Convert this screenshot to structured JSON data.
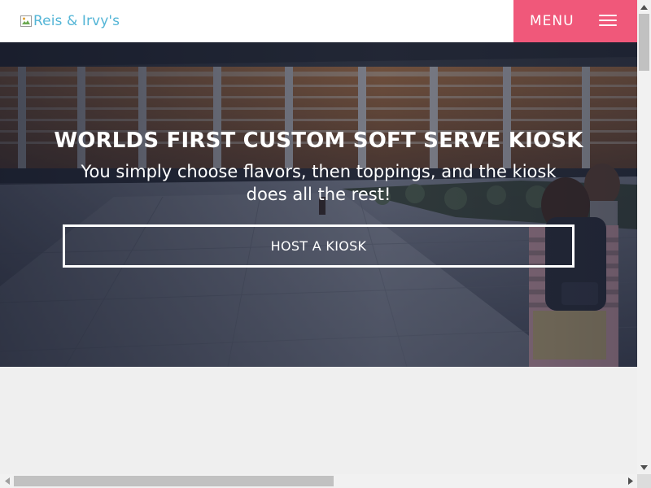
{
  "header": {
    "logo_alt": "Reis & Irvy's",
    "menu_label": "MENU"
  },
  "hero": {
    "title": "WORLDS FIRST CUSTOM SOFT SERVE KIOSK",
    "subtitle": "You simply choose flavors, then toppings, and the kiosk does all the rest!",
    "cta_label": "HOST A KIOSK"
  },
  "colors": {
    "menu_background": "#f0587a",
    "logo_text": "#53b5d6",
    "page_background": "#efefef"
  },
  "icons": {
    "logo": "broken-image-icon",
    "menu": "hamburger-icon",
    "scroll_up": "chevron-up-icon",
    "scroll_down": "chevron-down-icon",
    "scroll_left": "chevron-left-icon",
    "scroll_right": "chevron-right-icon"
  }
}
